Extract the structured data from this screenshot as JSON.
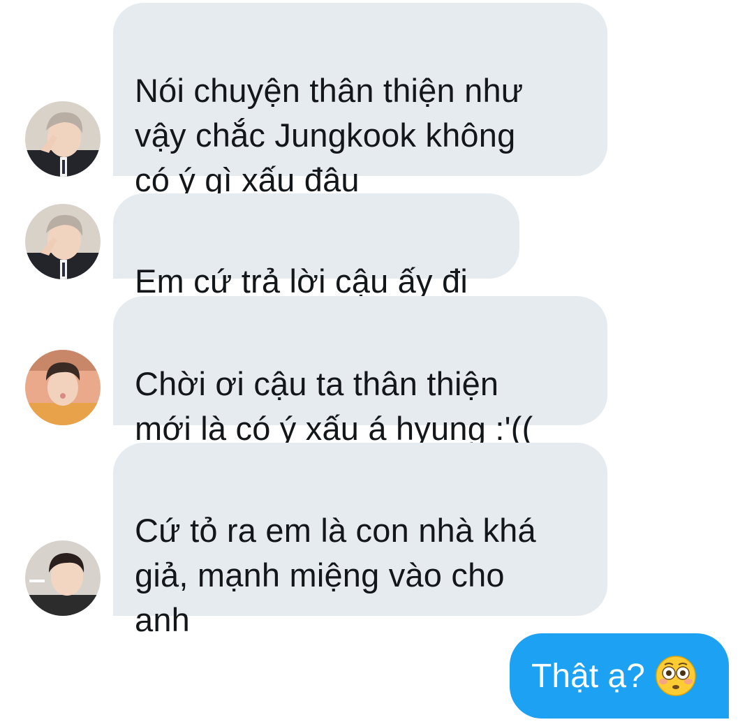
{
  "messages": [
    {
      "sender": "avatar-1",
      "text": "Nói chuyện thân thiện như\nvậy chắc Jungkook không\ncó ý gì xấu đâu"
    },
    {
      "sender": "avatar-1",
      "text": "Em cứ trả lời cậu ấy đi"
    },
    {
      "sender": "avatar-2",
      "text": "Chời ơi cậu ta thân thiện\nmới là có ý xấu á hyung :'(("
    },
    {
      "sender": "avatar-3",
      "text": "Cứ tỏ ra em là con nhà khá\ngiả, mạnh miệng vào cho\nanh"
    }
  ],
  "outgoing": {
    "text": "Thật ạ?",
    "emoji": "flushed-face-icon"
  },
  "colors": {
    "incoming_bubble": "#e6ebf0",
    "outgoing_bubble": "#1da1f2",
    "incoming_text": "#14171a",
    "outgoing_text": "#ffffff"
  }
}
